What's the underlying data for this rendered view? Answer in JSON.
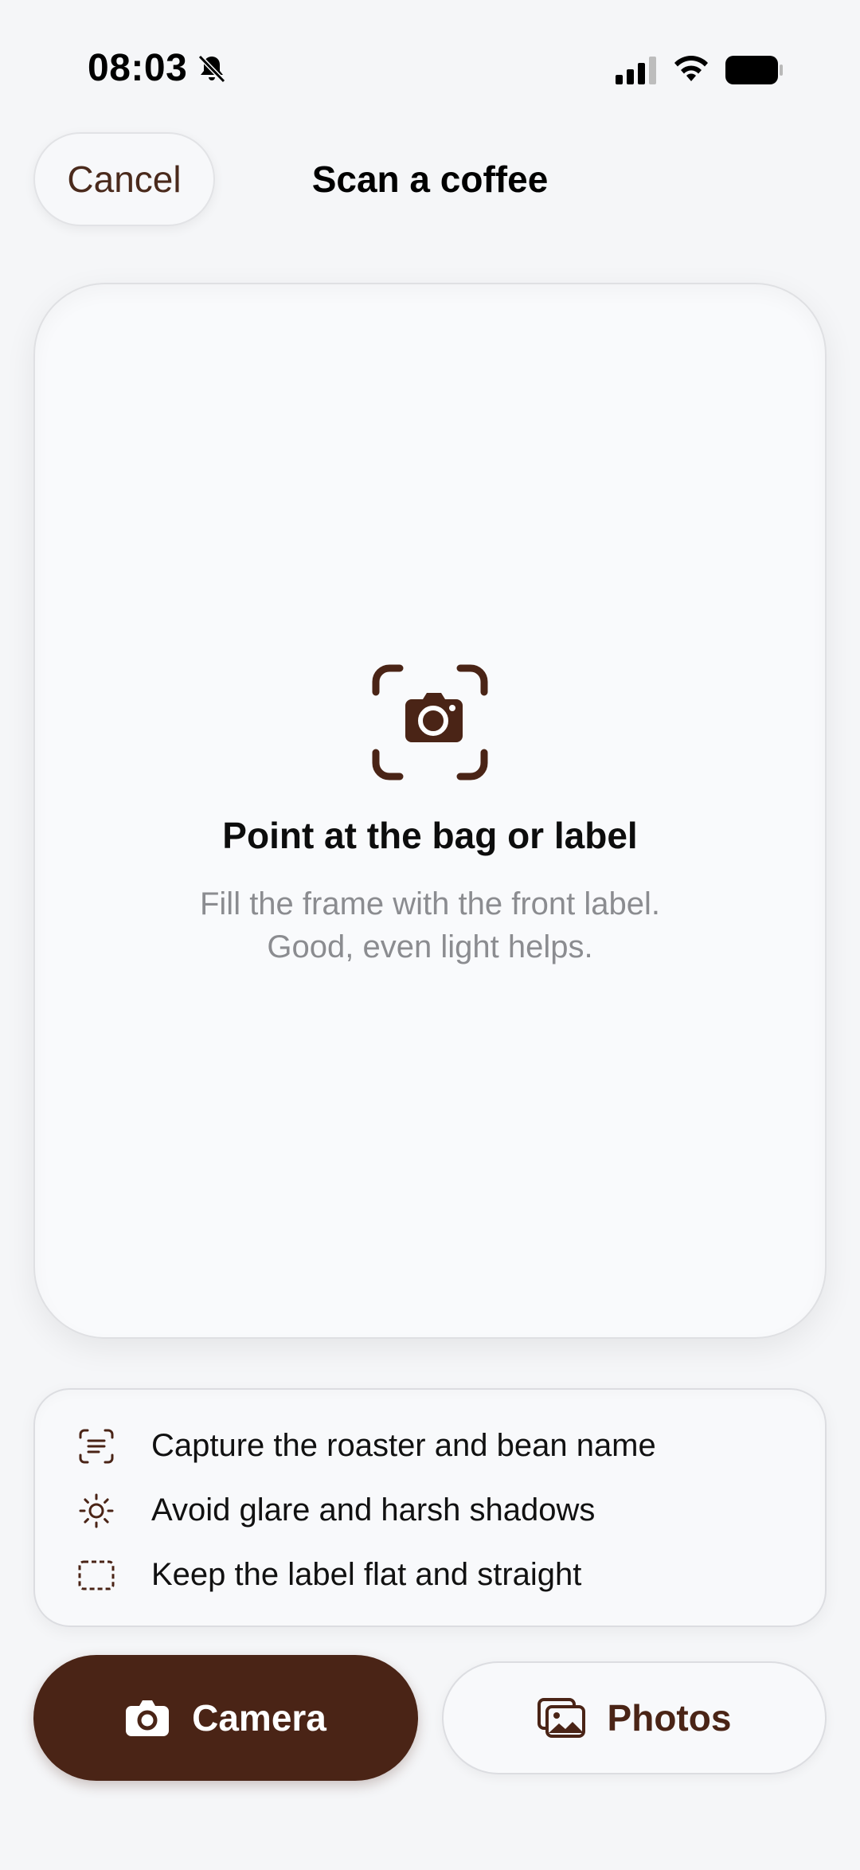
{
  "status_bar": {
    "time": "08:03",
    "icons": [
      "bell-slash-icon",
      "cellular-signal-icon",
      "wifi-icon",
      "battery-icon"
    ]
  },
  "header": {
    "cancel_label": "Cancel",
    "title": "Scan a coffee"
  },
  "scan_frame": {
    "icon": "camera-viewfinder-icon",
    "title": "Point at the bag or label",
    "subtitle_lines": [
      "Fill the frame with the front label.",
      "Good, even light helps."
    ]
  },
  "tips": [
    {
      "icon": "text-viewfinder-icon",
      "label": "Capture the roaster and bean name"
    },
    {
      "icon": "sun-icon",
      "label": "Avoid glare and harsh shadows"
    },
    {
      "icon": "dashed-rectangle-icon",
      "label": "Keep the label flat and straight"
    }
  ],
  "actions": {
    "camera": {
      "label": "Camera",
      "icon": "camera-icon"
    },
    "photos": {
      "label": "Photos",
      "icon": "photos-icon"
    }
  },
  "colors": {
    "accent": "#4a2416",
    "background": "#f5f6f8",
    "muted_text": "#8b8c90"
  }
}
